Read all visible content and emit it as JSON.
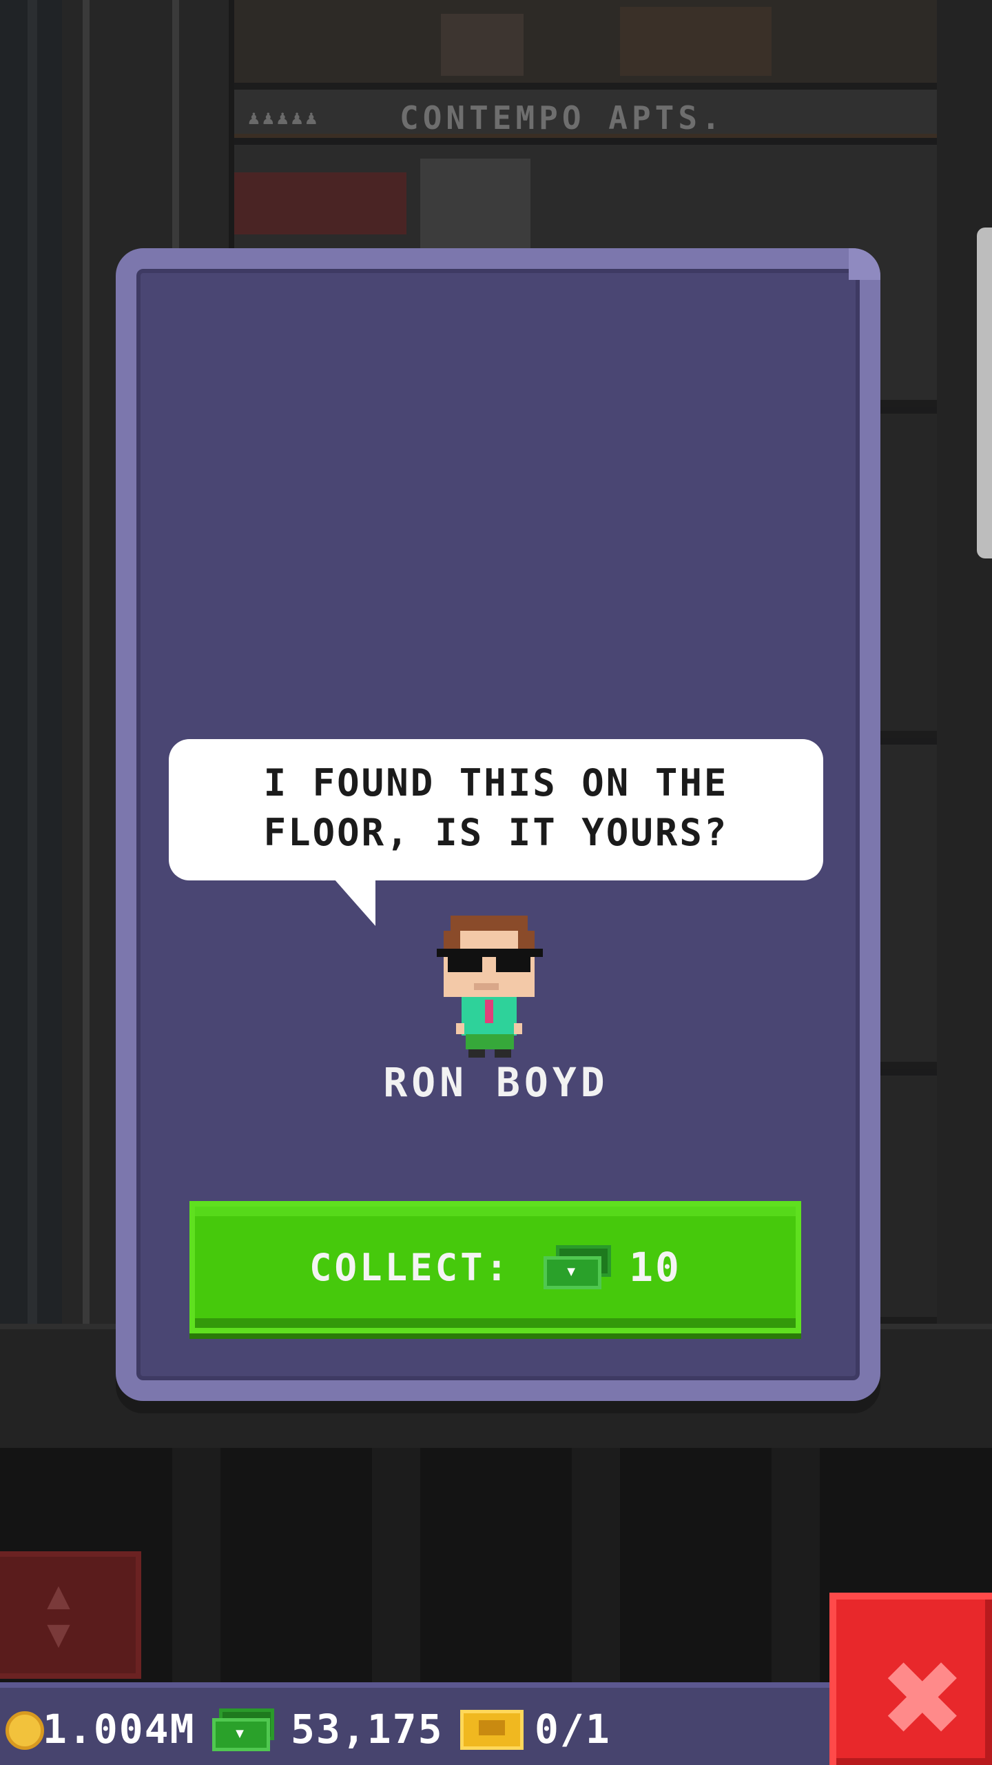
{
  "background": {
    "floor_sign": "CONTEMPO APTS.",
    "floor_sign_residents": "♟♟♟♟♟"
  },
  "dialog": {
    "speech": "I FOUND THIS ON THE\nFLOOR, IS IT YOURS?",
    "character_name": "RON BOYD",
    "collect_label": "COLLECT:",
    "collect_amount": "10",
    "collect_currency_icon": "tower-bux-icon"
  },
  "status_bar": {
    "coins": "1.004M",
    "bux": "53,175",
    "tickets": "0/1"
  },
  "controls": {
    "elevator_icon": "elevator-up-down-icon",
    "close_glyph": "✖"
  },
  "colors": {
    "card_bg": "#4a4673",
    "card_border": "#7c77ad",
    "collect_green": "#46c90c",
    "close_red": "#e8282b",
    "statusbar_bg": "#47446e"
  }
}
